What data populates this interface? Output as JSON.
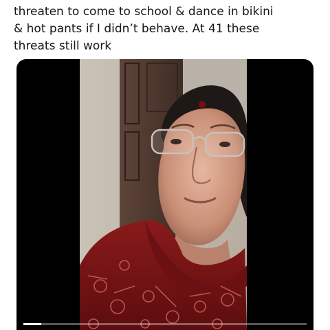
{
  "tweet": {
    "text_lines": [
      "threaten to come to school & dance in bikini",
      "& hot pants if I didn’t behave. At 41 these",
      "threats still work"
    ]
  },
  "video": {
    "progress": 0.063
  }
}
